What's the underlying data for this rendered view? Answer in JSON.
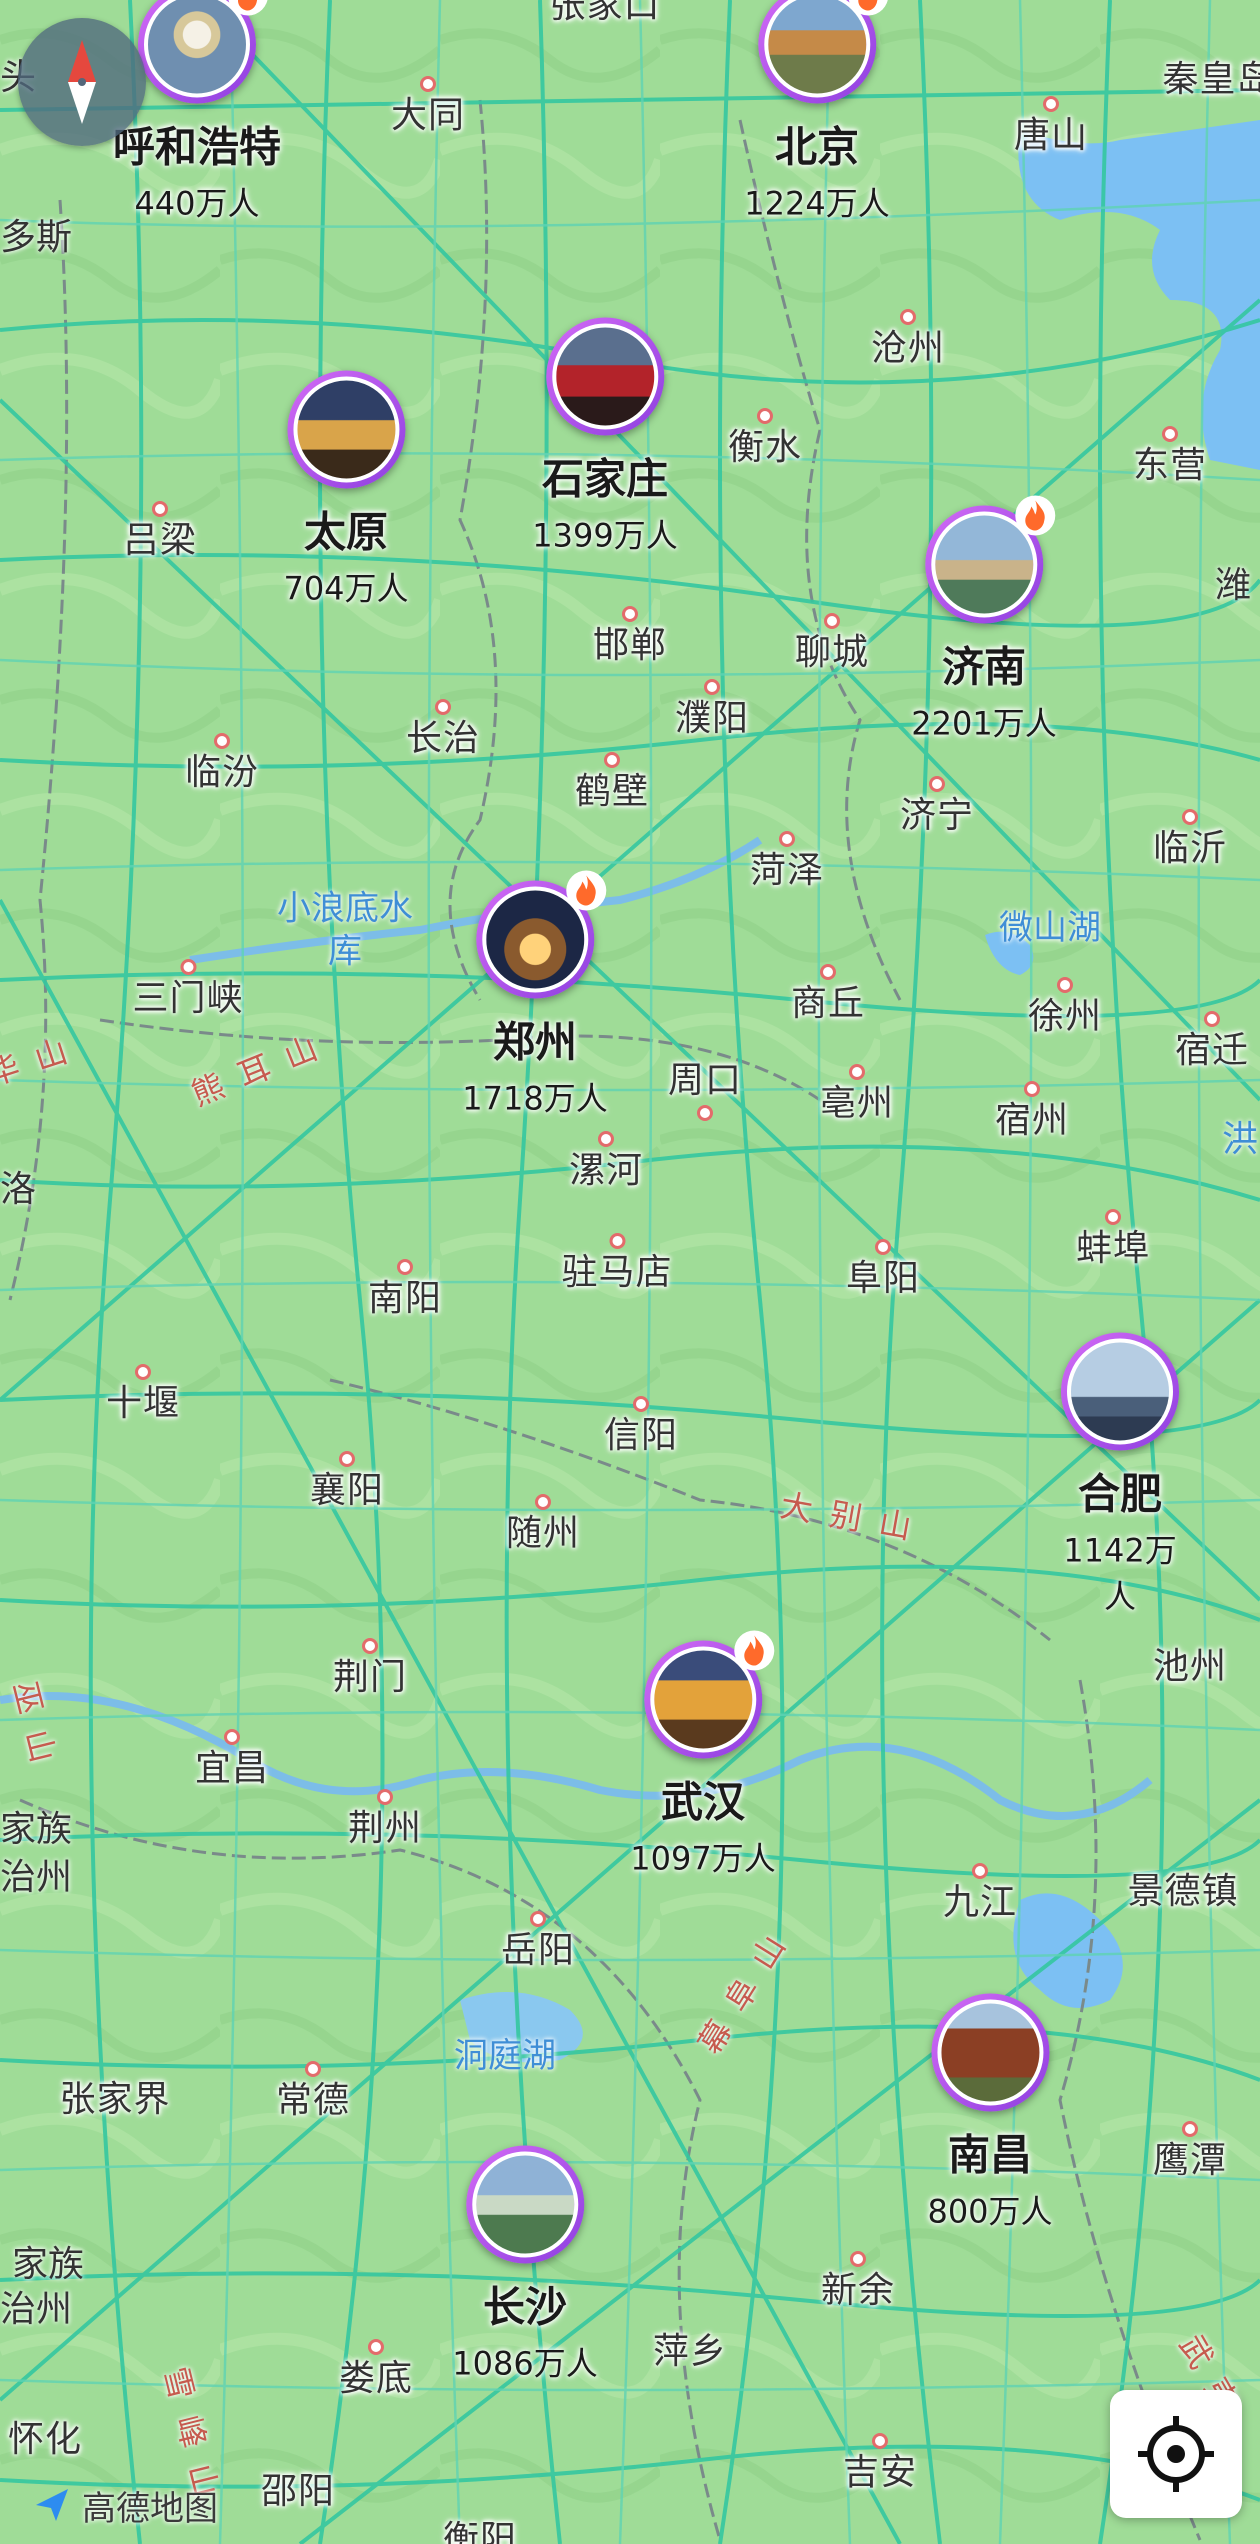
{
  "map": {
    "brand": "高德地图",
    "colors": {
      "land": "#9fdc97",
      "road": "#35c7a0",
      "water": "#7cc0f3",
      "marker_ring": "#a24be8",
      "city_dot": "#e36b6b"
    },
    "featured_cities": [
      {
        "key": "hohhot",
        "name": "呼和浩特",
        "population": "440万人",
        "hot": true
      },
      {
        "key": "beijing",
        "name": "北京",
        "population": "1224万人",
        "hot": true
      },
      {
        "key": "taiyuan",
        "name": "太原",
        "population": "704万人",
        "hot": false
      },
      {
        "key": "shijiazhuang",
        "name": "石家庄",
        "population": "1399万人",
        "hot": false
      },
      {
        "key": "jinan",
        "name": "济南",
        "population": "2201万人",
        "hot": true
      },
      {
        "key": "zhengzhou",
        "name": "郑州",
        "population": "1718万人",
        "hot": true
      },
      {
        "key": "hefei",
        "name": "合肥",
        "population": "1142万人",
        "hot": false
      },
      {
        "key": "wuhan",
        "name": "武汉",
        "population": "1097万人",
        "hot": true
      },
      {
        "key": "nanchang",
        "name": "南昌",
        "population": "800万人",
        "hot": false
      },
      {
        "key": "changsha",
        "name": "长沙",
        "population": "1086万人",
        "hot": false
      }
    ],
    "city_labels": [
      "张家口",
      "大同",
      "唐山",
      "秦皇岛",
      "沧州",
      "衡水",
      "东营",
      "吕梁",
      "邯郸",
      "聊城",
      "濮阳",
      "长治",
      "临汾",
      "鹤壁",
      "济宁",
      "临沂",
      "菏泽",
      "三门峡",
      "商丘",
      "徐州",
      "宿迁",
      "周口",
      "亳州",
      "宿州",
      "漯河",
      "驻马店",
      "阜阳",
      "蚌埠",
      "南阳",
      "十堰",
      "信阳",
      "襄阳",
      "随州",
      "荆门",
      "池州",
      "宜昌",
      "荆州",
      "九江",
      "景德镇",
      "岳阳",
      "常德",
      "张家界",
      "鹰潭",
      "新余",
      "萍乡",
      "娄底",
      "邵阳",
      "吉安",
      "怀化",
      "衡阳",
      "潍",
      "洛",
      "头",
      "多斯"
    ],
    "water_labels": [
      "小浪底水库",
      "微山湖",
      "洞庭湖"
    ],
    "mountain_labels": [
      "熊耳山",
      "大别山",
      "幕阜山",
      "雪峰山",
      "华山",
      "巫山",
      "武夷"
    ],
    "edge_labels": [
      "家族",
      "治州",
      "家族",
      "治州",
      "洪"
    ]
  }
}
